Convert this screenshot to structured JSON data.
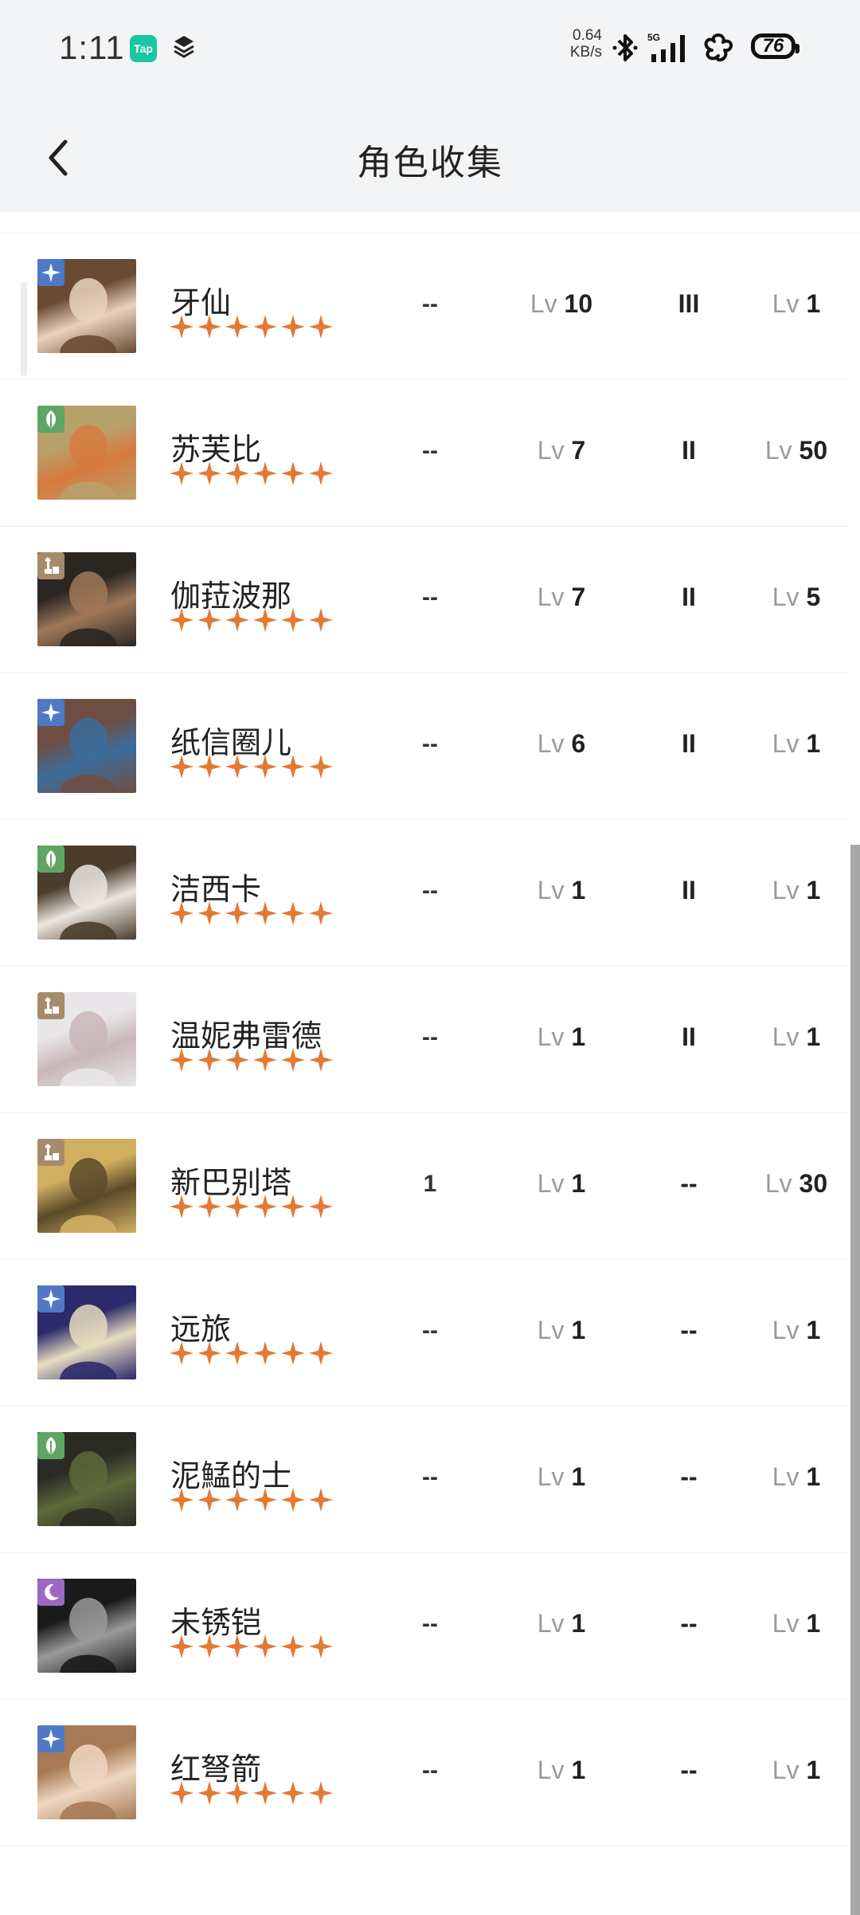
{
  "status_bar": {
    "time": "1:11",
    "tap_badge": "Tap",
    "net_speed_value": "0.64",
    "net_speed_unit": "KB/s",
    "signal_label": "5G",
    "battery": "76"
  },
  "header": {
    "title": "角色收集"
  },
  "colors": {
    "star": "#e27a35",
    "elem_star": "#4f79c6",
    "elem_leaf": "#5fa564",
    "elem_chess": "#a68b6b",
    "elem_moon": "#9d67c4"
  },
  "characters": [
    {
      "name": "牙仙",
      "element": "star",
      "stars": 6,
      "col1": "--",
      "lv_label": "Lv",
      "level": "10",
      "rank": "III",
      "lv2_label": "Lv",
      "level2": "1",
      "avatar_colors": [
        "#6b4a32",
        "#e9d3bc"
      ]
    },
    {
      "name": "苏芙比",
      "element": "leaf",
      "stars": 6,
      "col1": "--",
      "lv_label": "Lv",
      "level": "7",
      "rank": "II",
      "lv2_label": "Lv",
      "level2": "50",
      "avatar_colors": [
        "#b8a06a",
        "#d77a3f"
      ]
    },
    {
      "name": "伽菈波那",
      "element": "chess",
      "stars": 6,
      "col1": "--",
      "lv_label": "Lv",
      "level": "7",
      "rank": "II",
      "lv2_label": "Lv",
      "level2": "5",
      "avatar_colors": [
        "#2a2622",
        "#a07858"
      ]
    },
    {
      "name": "纸信圈儿",
      "element": "star",
      "stars": 6,
      "col1": "--",
      "lv_label": "Lv",
      "level": "6",
      "rank": "II",
      "lv2_label": "Lv",
      "level2": "1",
      "avatar_colors": [
        "#6e4e44",
        "#3b6d9a"
      ]
    },
    {
      "name": "洁西卡",
      "element": "leaf",
      "stars": 6,
      "col1": "--",
      "lv_label": "Lv",
      "level": "1",
      "rank": "II",
      "lv2_label": "Lv",
      "level2": "1",
      "avatar_colors": [
        "#4b3c2c",
        "#ece6df"
      ]
    },
    {
      "name": "温妮弗雷德",
      "element": "chess",
      "stars": 6,
      "col1": "--",
      "lv_label": "Lv",
      "level": "1",
      "rank": "II",
      "lv2_label": "Lv",
      "level2": "1",
      "avatar_colors": [
        "#e8e6e8",
        "#c9b6b8"
      ]
    },
    {
      "name": "新巴别塔",
      "element": "chess",
      "stars": 6,
      "col1": "1",
      "lv_label": "Lv",
      "level": "1",
      "rank": "--",
      "lv2_label": "Lv",
      "level2": "30",
      "avatar_colors": [
        "#d0b060",
        "#5a4a2a"
      ]
    },
    {
      "name": "远旅",
      "element": "star",
      "stars": 6,
      "col1": "--",
      "lv_label": "Lv",
      "level": "1",
      "rank": "--",
      "lv2_label": "Lv",
      "level2": "1",
      "avatar_colors": [
        "#2c2a6a",
        "#e8dcc0"
      ]
    },
    {
      "name": "泥鯭的士",
      "element": "leaf",
      "stars": 6,
      "col1": "--",
      "lv_label": "Lv",
      "level": "1",
      "rank": "--",
      "lv2_label": "Lv",
      "level2": "1",
      "avatar_colors": [
        "#2b2a24",
        "#5d6a3a"
      ]
    },
    {
      "name": "未锈铠",
      "element": "moon",
      "stars": 6,
      "col1": "--",
      "lv_label": "Lv",
      "level": "1",
      "rank": "--",
      "lv2_label": "Lv",
      "level2": "1",
      "avatar_colors": [
        "#1a1a1a",
        "#9a9a9a"
      ]
    },
    {
      "name": "红弩箭",
      "element": "star",
      "stars": 6,
      "col1": "--",
      "lv_label": "Lv",
      "level": "1",
      "rank": "--",
      "lv2_label": "Lv",
      "level2": "1",
      "avatar_colors": [
        "#a77a55",
        "#efd8c2"
      ]
    }
  ]
}
